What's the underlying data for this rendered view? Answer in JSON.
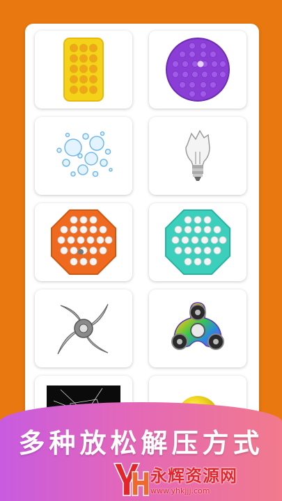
{
  "slogan": "多种放松解压方式",
  "watermark": {
    "logo_letters": "YH",
    "name": "永辉资源网",
    "url": "www.yhkjjj.com"
  },
  "colors": {
    "background_orange": "#e8780f",
    "band_start": "#c85be0",
    "band_end": "#f27a8c",
    "watermark_red": "#e3262b"
  },
  "items": [
    {
      "name": "yellow-rectangle-pop-it"
    },
    {
      "name": "purple-round-pop-it"
    },
    {
      "name": "bubbles"
    },
    {
      "name": "broken-light-bulb"
    },
    {
      "name": "orange-octagon-pop-it"
    },
    {
      "name": "teal-octagon-pop-it"
    },
    {
      "name": "shuriken"
    },
    {
      "name": "rainbow-fidget-spinner"
    },
    {
      "name": "cracked-glass"
    },
    {
      "name": "yellow-ball"
    }
  ]
}
